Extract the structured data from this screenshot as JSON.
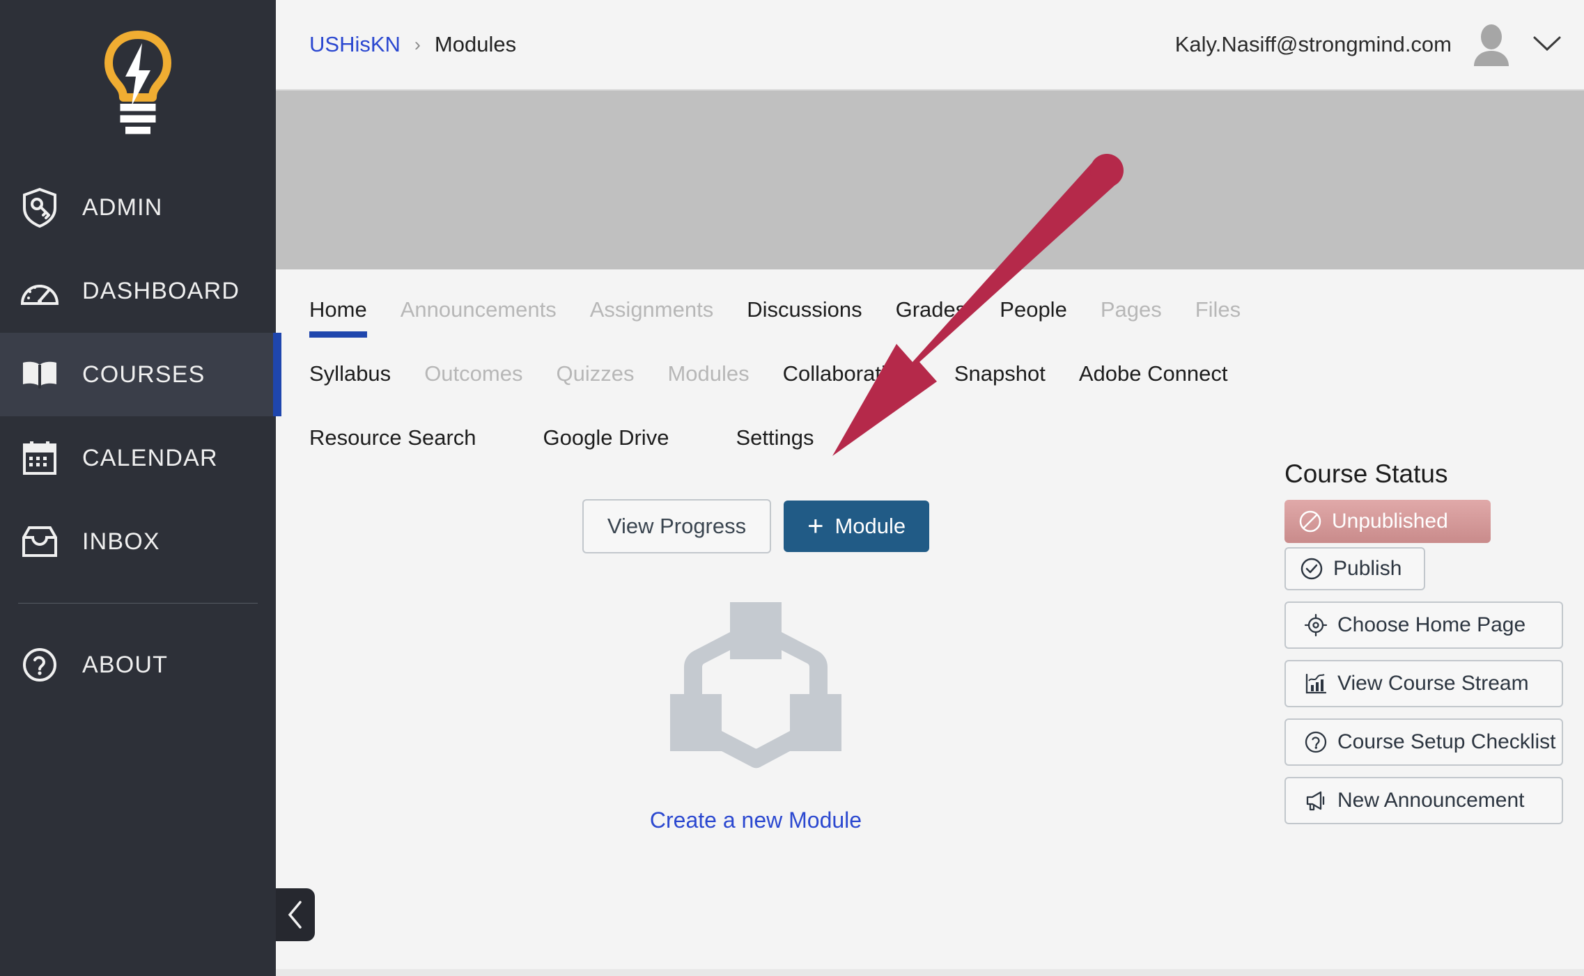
{
  "app": {
    "brand_icon": "lightbulb-logo",
    "accent_blue": "#1f46ad",
    "sidebar_bg": "#2d3038",
    "annotation_color": "#b5294a",
    "primary_button_bg": "#215b86"
  },
  "sidebar": {
    "items": [
      {
        "label": "ADMIN",
        "icon": "shield-key-icon",
        "active": false
      },
      {
        "label": "DASHBOARD",
        "icon": "gauge-icon",
        "active": false
      },
      {
        "label": "COURSES",
        "icon": "book-icon",
        "active": true
      },
      {
        "label": "CALENDAR",
        "icon": "calendar-icon",
        "active": false
      },
      {
        "label": "INBOX",
        "icon": "inbox-icon",
        "active": false
      },
      {
        "label": "ABOUT",
        "icon": "question-circle-icon",
        "active": false
      }
    ],
    "collapse_icon": "chevron-left-icon"
  },
  "header": {
    "breadcrumb": {
      "course": "USHisKN",
      "separator": "›",
      "current": "Modules"
    },
    "user_email": "Kaly.Nasiff@strongmind.com",
    "avatar_icon": "user-avatar-icon",
    "caret_icon": "chevron-down-icon"
  },
  "course_nav": {
    "rows": [
      [
        {
          "label": "Home",
          "state": "active"
        },
        {
          "label": "Announcements",
          "state": "disabled"
        },
        {
          "label": "Assignments",
          "state": "disabled"
        },
        {
          "label": "Discussions",
          "state": "normal"
        },
        {
          "label": "Grades",
          "state": "normal"
        },
        {
          "label": "People",
          "state": "normal"
        },
        {
          "label": "Pages",
          "state": "disabled"
        },
        {
          "label": "Files",
          "state": "disabled"
        }
      ],
      [
        {
          "label": "Syllabus",
          "state": "normal"
        },
        {
          "label": "Outcomes",
          "state": "disabled"
        },
        {
          "label": "Quizzes",
          "state": "disabled"
        },
        {
          "label": "Modules",
          "state": "disabled"
        },
        {
          "label": "Collaborations",
          "state": "normal"
        },
        {
          "label": "Snapshot",
          "state": "normal"
        },
        {
          "label": "Adobe Connect",
          "state": "normal"
        }
      ],
      [
        {
          "label": "Resource Search",
          "state": "normal"
        },
        {
          "label": "Google Drive",
          "state": "normal"
        },
        {
          "label": "Settings",
          "state": "normal"
        }
      ]
    ]
  },
  "toolbar": {
    "view_progress_label": "View Progress",
    "add_module_plus": "+",
    "add_module_label": "Module"
  },
  "empty_state": {
    "illustration_icon": "module-hierarchy-icon",
    "create_link_label": "Create a new Module"
  },
  "course_status": {
    "title": "Course Status",
    "unpublished": {
      "label": "Unpublished",
      "icon": "no-entry-icon"
    },
    "publish": {
      "label": "Publish",
      "icon": "check-circle-icon"
    },
    "actions": [
      {
        "label": "Choose Home Page",
        "icon": "target-icon"
      },
      {
        "label": "View Course Stream",
        "icon": "bar-chart-icon"
      },
      {
        "label": "Course Setup Checklist",
        "icon": "question-circle-icon"
      },
      {
        "label": "New Announcement",
        "icon": "megaphone-icon"
      }
    ]
  },
  "annotation": {
    "type": "arrow",
    "points_to": "Settings",
    "color": "#b5294a"
  }
}
